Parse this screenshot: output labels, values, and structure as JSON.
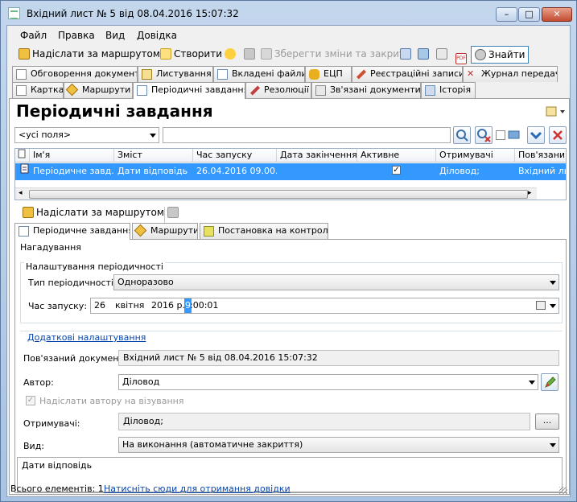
{
  "window": {
    "title": "Вхідний лист № 5 від 08.04.2016 15:07:32",
    "minimize": "–",
    "maximize": "□",
    "close": "✕"
  },
  "menu": [
    "Файл",
    "Правка",
    "Вид",
    "Довідка"
  ],
  "toolbar": {
    "send_route": "Надіслати за маршрутом",
    "create": "Створити",
    "save_close": "Зберегти зміни та закрити",
    "find": "Знайти"
  },
  "tabs_row1": [
    "Обговорення документа",
    "Листування",
    "Вкладені файли",
    "ЕЦП",
    "Реєстраційні записи",
    "Журнал передачі"
  ],
  "tabs_row2": [
    "Картка",
    "Маршрути",
    "Періодичні завдання",
    "Резолюції",
    "Зв'язані документи",
    "Історія"
  ],
  "page": {
    "title": "Періодичні завдання"
  },
  "search": {
    "field_select": "<усі поля>",
    "query": ""
  },
  "grid": {
    "columns": [
      "Ім'я",
      "Зміст",
      "Час запуску",
      "Дата закінчення",
      "Активне",
      "Отримувачі",
      "Пов'язаний"
    ],
    "rows": [
      {
        "name": "Періодичне завд...",
        "content": "Дати відповідь",
        "start": "26.04.2016 09.00...",
        "end": "",
        "active": true,
        "recipients": "Діловод;",
        "linked": "Вхідний лист"
      }
    ]
  },
  "detail_toolbar": {
    "send_route": "Надіслати за маршрутом"
  },
  "detail_tabs": [
    "Періодичне завдання",
    "Маршрути",
    "Постановка на контроль"
  ],
  "form": {
    "reminder_label": "Нагадування",
    "periodic_settings_label": "Налаштування періодичності",
    "period_type_label": "Тип періодичності:",
    "period_type_value": "Одноразово",
    "start_time_label": "Час запуску:",
    "start_day": "26",
    "start_month": "квітня",
    "start_year": "2016 р.",
    "start_hour": "9",
    "start_rest": ":00:01",
    "advanced_link": "Додаткові налаштування",
    "linked_doc_label": "Пов'язаний документ:",
    "linked_doc_value": "Вхідний лист № 5 від 08.04.2016 15:07:32",
    "author_label": "Автор:",
    "author_value": "Діловод",
    "send_author_label": "Надіслати автору на візування",
    "send_author_checked": true,
    "recipients_label": "Отримувачі:",
    "recipients_value": "Діловод;",
    "browse": "...",
    "kind_label": "Вид:",
    "kind_value": "На виконання (автоматичне закриття)",
    "content_value": "Дати відповідь"
  },
  "status": {
    "count": "Всього елементів: 1",
    "help_link": "Натисніть сюди для отримання довідки"
  }
}
